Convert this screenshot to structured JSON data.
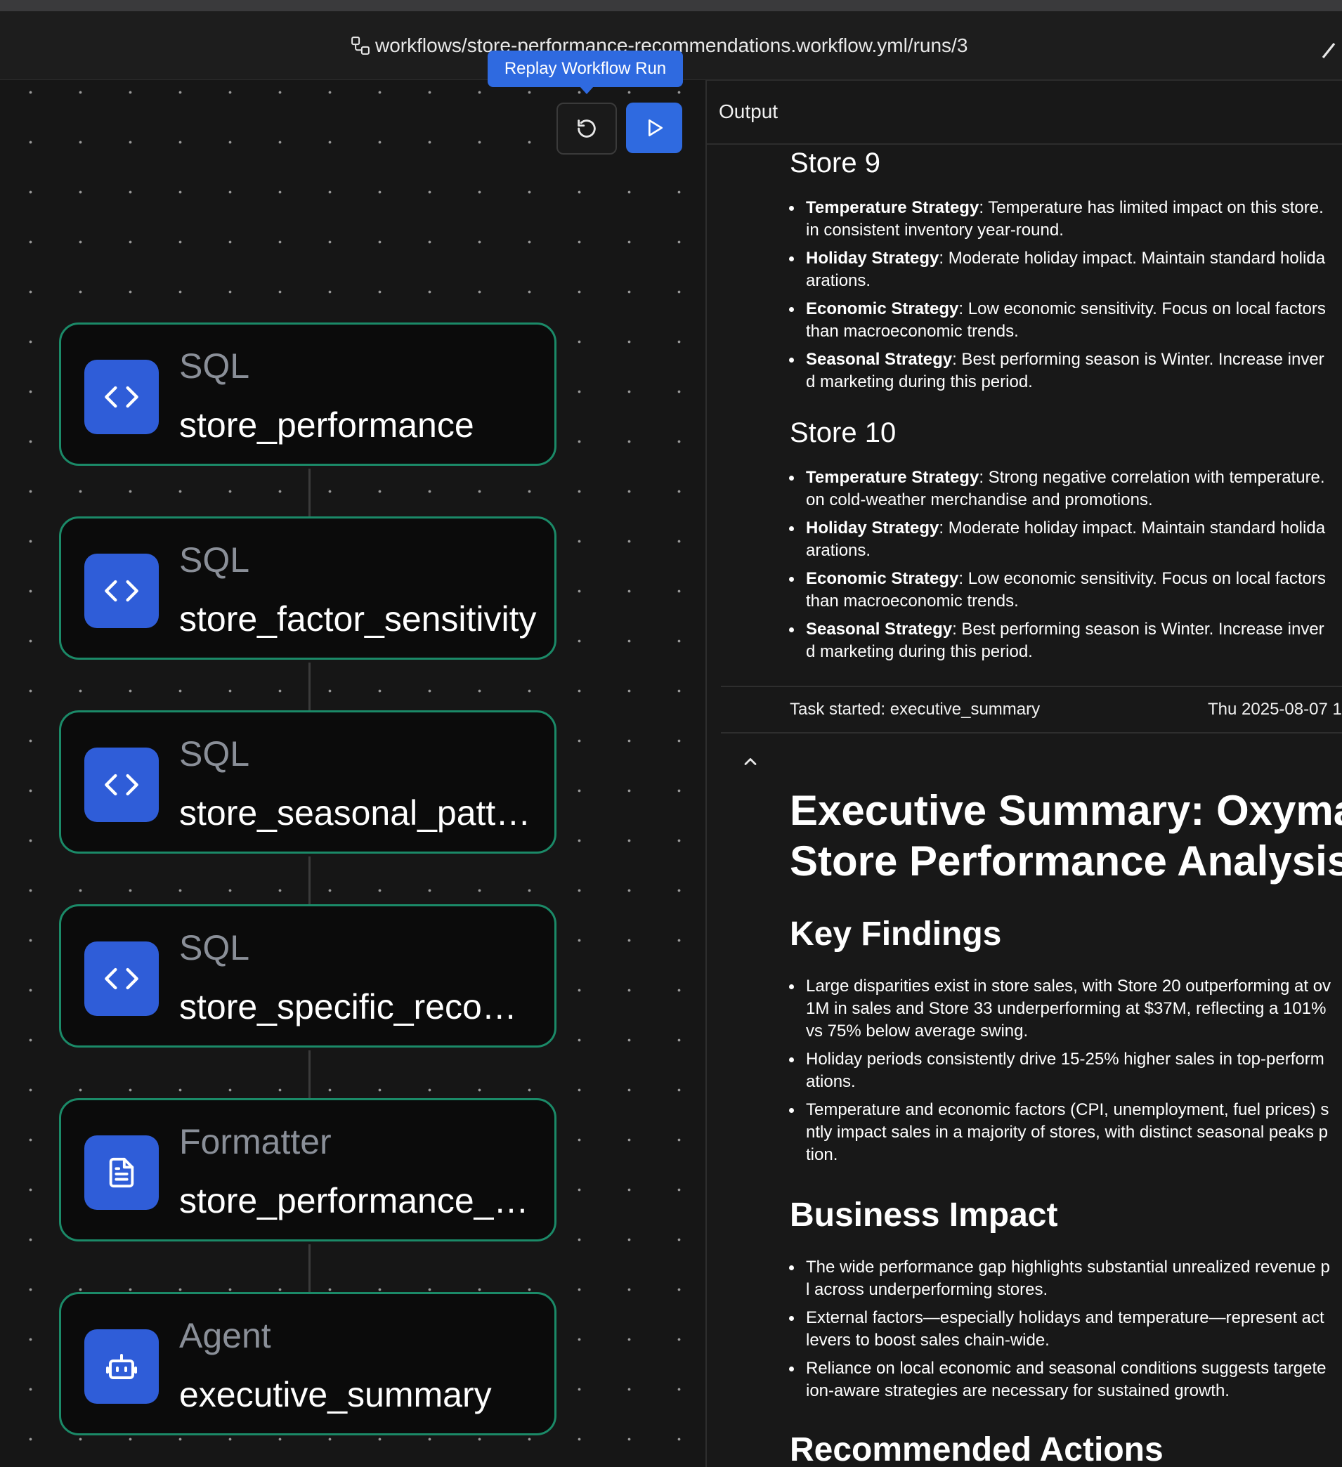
{
  "header": {
    "path": "workflows/store-performance-recommendations.workflow.yml/runs/3"
  },
  "toolbar": {
    "tooltip": "Replay Workflow Run",
    "replay_icon": "refresh-icon",
    "run_icon": "play-icon"
  },
  "nodes": [
    {
      "type": "SQL",
      "name": "store_performance",
      "icon": "code-icon"
    },
    {
      "type": "SQL",
      "name": "store_factor_sensitivity",
      "icon": "code-icon"
    },
    {
      "type": "SQL",
      "name": "store_seasonal_patt…",
      "icon": "code-icon"
    },
    {
      "type": "SQL",
      "name": "store_specific_reco…",
      "icon": "code-icon"
    },
    {
      "type": "Formatter",
      "name": "store_performance_…",
      "icon": "document-icon"
    },
    {
      "type": "Agent",
      "name": "executive_summary",
      "icon": "robot-icon"
    }
  ],
  "output": {
    "title": "Output",
    "stores": [
      {
        "title": "Store 9",
        "items": [
          {
            "label": "Temperature Strategy",
            "l1": ": Temperature has limited impact on this store.",
            "l2": "in consistent inventory year-round."
          },
          {
            "label": "Holiday Strategy",
            "l1": ": Moderate holiday impact. Maintain standard holida",
            "l2": "arations."
          },
          {
            "label": "Economic Strategy",
            "l1": ": Low economic sensitivity. Focus on local factors",
            "l2": "than macroeconomic trends."
          },
          {
            "label": "Seasonal Strategy",
            "l1": ": Best performing season is Winter. Increase inver",
            "l2": "d marketing during this period."
          }
        ]
      },
      {
        "title": "Store 10",
        "items": [
          {
            "label": "Temperature Strategy",
            "l1": ": Strong negative correlation with temperature.",
            "l2": "on cold-weather merchandise and promotions."
          },
          {
            "label": "Holiday Strategy",
            "l1": ": Moderate holiday impact. Maintain standard holida",
            "l2": "arations."
          },
          {
            "label": "Economic Strategy",
            "l1": ": Low economic sensitivity. Focus on local factors",
            "l2": "than macroeconomic trends."
          },
          {
            "label": "Seasonal Strategy",
            "l1": ": Best performing season is Winter. Increase inver",
            "l2": "d marketing during this period."
          }
        ]
      }
    ],
    "task": {
      "label": "Task started: executive_summary",
      "time": "Thu 2025-08-07 1"
    },
    "summary": {
      "h1_line1": "Executive Summary: Oxyma",
      "h1_line2": "Store Performance Analysis",
      "key_findings": {
        "heading": "Key Findings",
        "items": [
          [
            "Large disparities exist in store sales, with Store 20 outperforming at ov",
            "1M in sales and Store 33 underperforming at $37M, reflecting a 101%",
            "vs 75% below average swing."
          ],
          [
            "Holiday periods consistently drive 15-25% higher sales in top-perform",
            "ations."
          ],
          [
            "Temperature and economic factors (CPI, unemployment, fuel prices) s",
            "ntly impact sales in a majority of stores, with distinct seasonal peaks p",
            "tion."
          ]
        ]
      },
      "business_impact": {
        "heading": "Business Impact",
        "items": [
          [
            "The wide performance gap highlights substantial unrealized revenue p",
            "l across underperforming stores."
          ],
          [
            "External factors—especially holidays and temperature—represent act",
            "levers to boost sales chain-wide."
          ],
          [
            "Reliance on local economic and seasonal conditions suggests targete",
            "ion-aware strategies are necessary for sustained growth."
          ]
        ]
      },
      "recommended_actions": {
        "heading": "Recommended Actions"
      }
    }
  }
}
